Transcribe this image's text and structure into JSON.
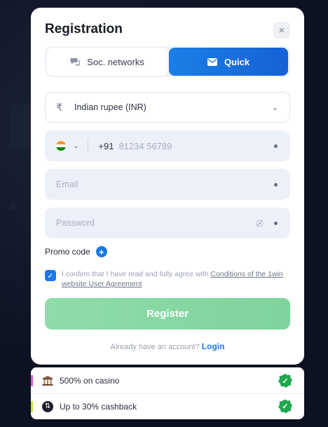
{
  "modal": {
    "title": "Registration",
    "close_icon": "×"
  },
  "tabs": [
    {
      "label": "Soc. networks",
      "icon": "chat-bubbles-icon",
      "active": false
    },
    {
      "label": "Quick",
      "icon": "envelope-icon",
      "active": true
    }
  ],
  "form": {
    "currency": {
      "icon": "₹",
      "value": "Indian rupee (INR)"
    },
    "phone": {
      "country_code": "+91",
      "placeholder": "81234 56789"
    },
    "email": {
      "placeholder": "Email"
    },
    "password": {
      "placeholder": "Password"
    },
    "promo_label": "Promo code",
    "agreement": {
      "text": "I confirm that I have read and fully agree with ",
      "link": "Conditions of the 1win website User Agreement",
      "checked": true
    },
    "submit_label": "Register",
    "login_prompt": "Already have an account? ",
    "login_link": "Login"
  },
  "bonuses": [
    {
      "text": "500% on casino",
      "bar_color": "#d65ad6",
      "icon": "casino-building-icon"
    },
    {
      "text": "Up to 30% cashback",
      "bar_color": "#c7e23a",
      "icon": "cashback-coin-icon"
    }
  ],
  "colors": {
    "accent": "#1a78e8",
    "register": "#7fd39d",
    "check": "#1fa74f"
  }
}
